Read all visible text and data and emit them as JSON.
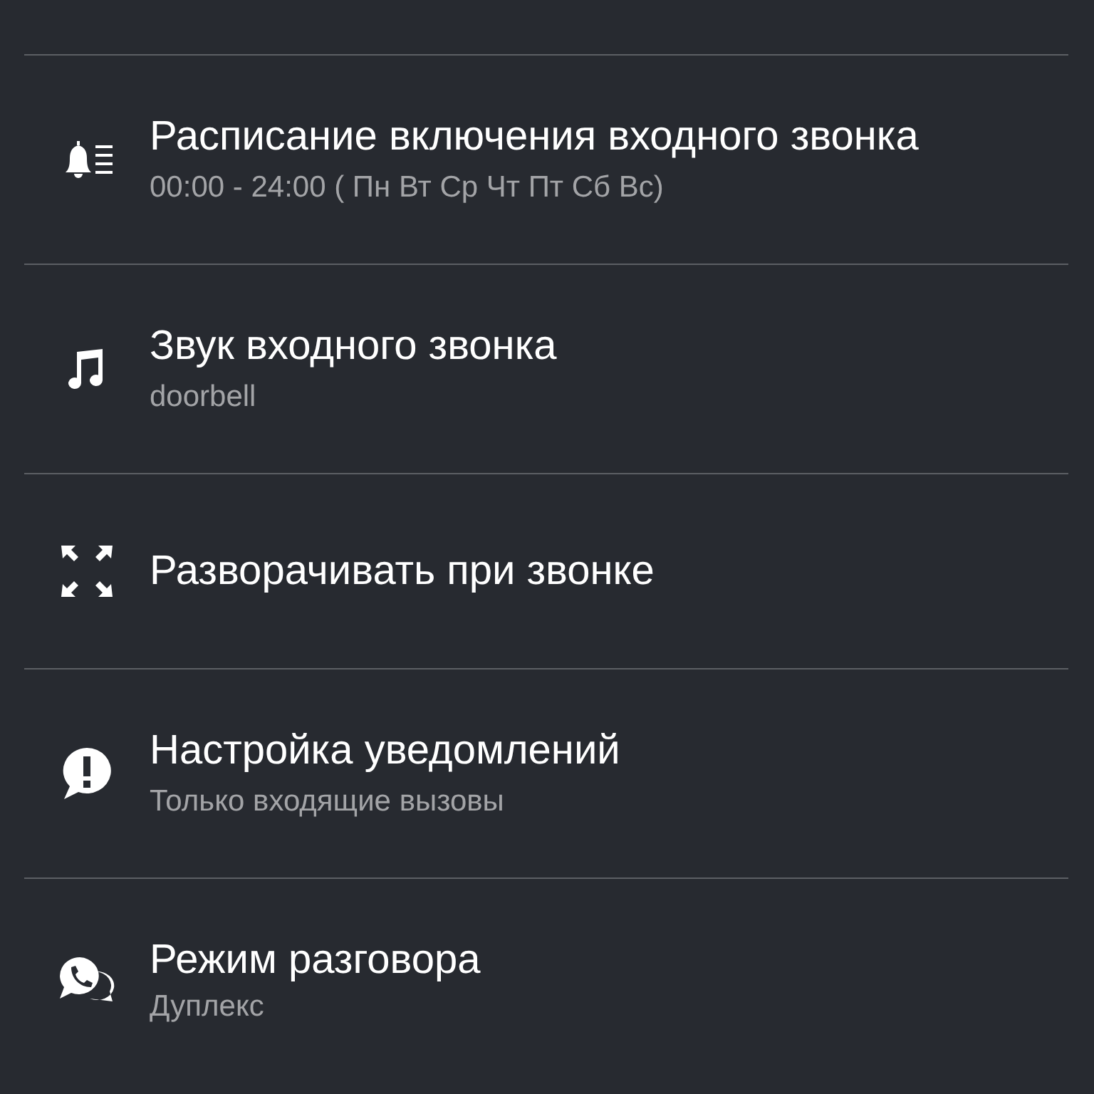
{
  "settings": [
    {
      "title": "Расписание включения входного звонка",
      "subtitle": "00:00 - 24:00 ( Пн Вт Ср Чт Пт Сб Вс)"
    },
    {
      "title": "Звук входного звонка",
      "subtitle": "doorbell"
    },
    {
      "title": "Разворачивать при звонке"
    },
    {
      "title": "Настройка уведомлений",
      "subtitle": "Только входящие вызовы"
    },
    {
      "title": "Режим разговора",
      "subtitle": "Дуплекс"
    }
  ]
}
